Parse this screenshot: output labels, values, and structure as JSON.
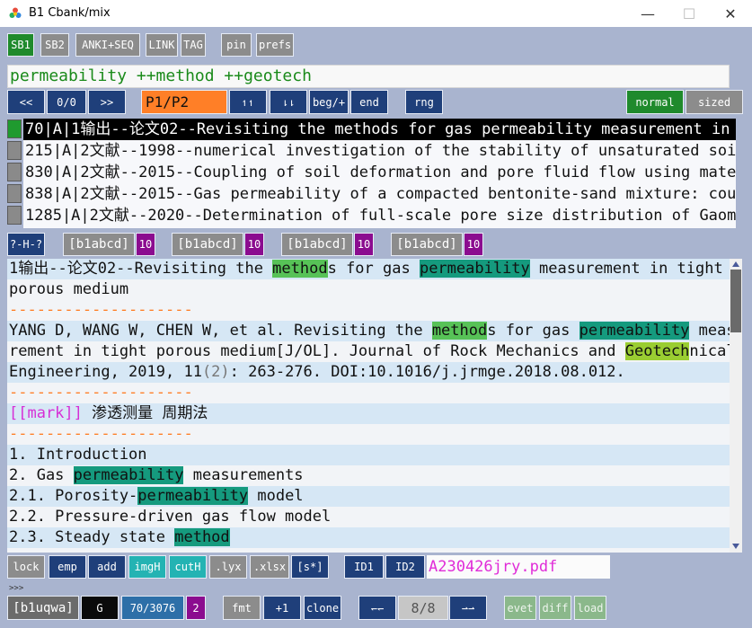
{
  "window": {
    "title": "B1 Cbank/mix",
    "minimize": "—",
    "maximize": "☐",
    "close": "✕"
  },
  "toolbar": {
    "sb1": "SB1",
    "sb2": "SB2",
    "anki": "ANKI+SEQ",
    "link": "LINK",
    "tag": "TAG",
    "pin": "pin",
    "prefs": "prefs"
  },
  "search": {
    "value": "permeability ++method ++geotech"
  },
  "nav": {
    "prev": "<<",
    "counter": "0/0",
    "next": ">>",
    "page": "P1/P2",
    "up": "↿↿",
    "down": "⇂⇂",
    "beg": "beg/+",
    "end": "end",
    "rng": "rng",
    "normal": "normal",
    "sized": "sized"
  },
  "results": [
    "  70|A|1输出--论文02--Revisiting the methods for gas permeability measurement in",
    " 215|A|2文献--1998--numerical investigation of the stability of unsaturated soil",
    " 830|A|2文献--2015--Coupling of soil deformation and pore fluid flow using mater",
    " 838|A|2文献--2015--Gas permeability of a compacted bentonite-sand mixture: coup",
    "1285|A|2文献--2020--Determination of full-scale pore size distribution of Gaomia"
  ],
  "midbar": {
    "help": "?-H-?",
    "slots": [
      "[b1abcd]",
      "[b1abcd]",
      "[b1abcd]",
      "[b1abcd]"
    ],
    "counts": [
      "10",
      "10",
      "10",
      "10"
    ]
  },
  "detail": {
    "l1a": "1输出--论文02--Revisiting the ",
    "l1b": "method",
    "l1c": "s for gas ",
    "l1d": "permeability",
    "l1e": " measurement in tight",
    "l2": "porous medium",
    "sep": "--------------------",
    "l4a": "YANG D, WANG W, CHEN W, et al. Revisiting the ",
    "l4b": "method",
    "l4c": "s for gas ",
    "l4d": "permeability",
    "l4e": " measu",
    "l5a": "rement in tight porous medium[J/OL]. Journal of Rock Mechanics and ",
    "l5b": "Geotech",
    "l5c": "nical",
    "l6a": "Engineering, 2019, 11",
    "l6b": "(2)",
    "l6c": ": 263-276. DOI:10.1016/j.jrmge.2018.08.012.",
    "l8a": "[[mark]]",
    "l8b": " 渗透测量 周期法",
    "l10": "1. Introduction",
    "l11a": "2. Gas ",
    "l11b": "permeability",
    "l11c": " measurements",
    "l12a": "2.1. Porosity-",
    "l12b": "permeability",
    "l12c": " model",
    "l13": "2.2. Pressure-driven gas flow model",
    "l14a": "2.3. Steady state ",
    "l14b": "method"
  },
  "actions": {
    "lock": "lock",
    "emp": "emp",
    "add": "add",
    "imgH": "imgH",
    "cutH": "cutH",
    "lyx": ".lyx",
    "xlsx": ".xlsx",
    "star": "[s*]",
    "id1": "ID1",
    "id2": "ID2",
    "filename": "A230426jry.pdf"
  },
  "prompt": ">>>",
  "bottom": {
    "tag": "[b1uqwa]",
    "g": "G",
    "count": "70/3076",
    "num": "2",
    "fmt": "fmt",
    "plus1": "+1",
    "clone": "clone",
    "left": "↽↽",
    "pos": "8/8",
    "right": "⇀⇀",
    "evet": "evet",
    "diff": "diff",
    "load": "load"
  }
}
